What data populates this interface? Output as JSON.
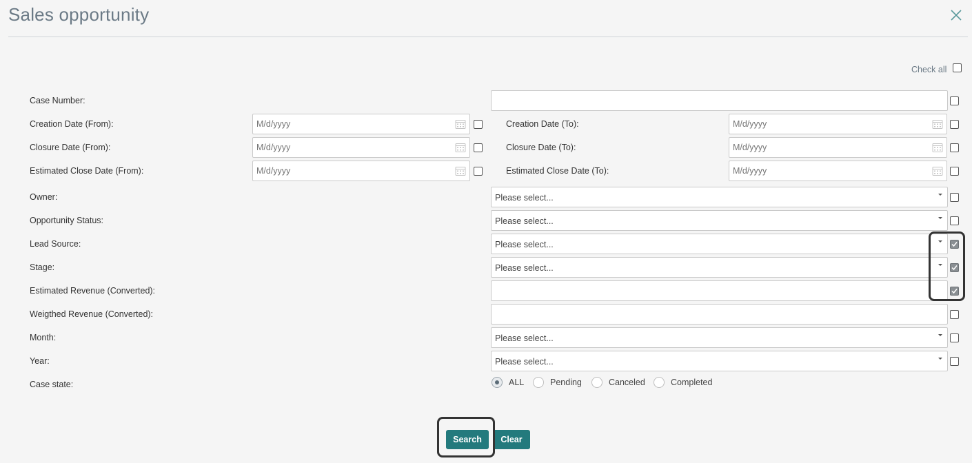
{
  "header": {
    "title": "Sales opportunity"
  },
  "check_all": {
    "label": "Check all",
    "checked": false
  },
  "fields": {
    "case_number": {
      "label": "Case Number:",
      "value": ""
    },
    "creation_from": {
      "label": "Creation Date (From):",
      "placeholder": "M/d/yyyy"
    },
    "creation_to": {
      "label": "Creation Date (To):",
      "placeholder": "M/d/yyyy"
    },
    "closure_from": {
      "label": "Closure Date (From):",
      "placeholder": "M/d/yyyy"
    },
    "closure_to": {
      "label": "Closure Date (To):",
      "placeholder": "M/d/yyyy"
    },
    "est_close_from": {
      "label": "Estimated Close Date (From):",
      "placeholder": "M/d/yyyy"
    },
    "est_close_to": {
      "label": "Estimated Close Date (To):",
      "placeholder": "M/d/yyyy"
    },
    "owner": {
      "label": "Owner:",
      "value": "Please select..."
    },
    "opportunity_status": {
      "label": "Opportunity Status:",
      "value": "Please select..."
    },
    "lead_source": {
      "label": "Lead Source:",
      "value": "Please select...",
      "checked": true
    },
    "stage": {
      "label": "Stage:",
      "value": "Please select...",
      "checked": true
    },
    "estimated_revenue": {
      "label": "Estimated Revenue (Converted):",
      "value": "",
      "checked": true
    },
    "weighted_revenue": {
      "label": "Weigthed Revenue (Converted):",
      "value": ""
    },
    "month": {
      "label": "Month:",
      "value": "Please select..."
    },
    "year": {
      "label": "Year:",
      "value": "Please select..."
    },
    "case_state": {
      "label": "Case state:",
      "options": [
        "ALL",
        "Pending",
        "Canceled",
        "Completed"
      ],
      "selected": "ALL"
    }
  },
  "buttons": {
    "search": "Search",
    "clear": "Clear"
  },
  "colors": {
    "accent": "#237a7d",
    "title": "#6b7a86",
    "background": "#f5f5f5"
  }
}
